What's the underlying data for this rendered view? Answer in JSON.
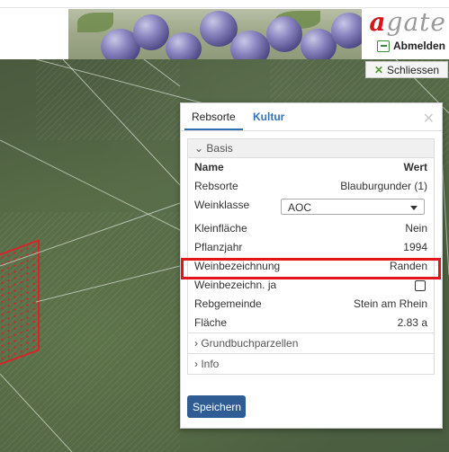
{
  "header": {
    "logo_a": "a",
    "logo_rest": "gate",
    "logout_label": "Abmelden"
  },
  "map": {
    "close_label": "Schliessen"
  },
  "dialog": {
    "tabs": [
      {
        "label": "Rebsorte",
        "active": true
      },
      {
        "label": "Kultur",
        "active": false
      }
    ],
    "close_glyph": "✕",
    "section_basis": "⌄ Basis",
    "columns": {
      "name": "Name",
      "value": "Wert"
    },
    "rows": {
      "rebsorte": {
        "label": "Rebsorte",
        "value": "Blauburgunder (1)"
      },
      "weinklasse": {
        "label": "Weinklasse",
        "value": "AOC"
      },
      "kleinflaeche": {
        "label": "Kleinfläche",
        "value": "Nein"
      },
      "pflanzjahr": {
        "label": "Pflanzjahr",
        "value": "1994"
      },
      "weinbezeichnung": {
        "label": "Weinbezeichnung",
        "value": "Randen"
      },
      "weinbezeichn_ja": {
        "label": "Weinbezeichn. ja",
        "checked": false
      },
      "rebgemeinde": {
        "label": "Rebgemeinde",
        "value": "Stein am Rhein"
      },
      "flaeche": {
        "label": "Fläche",
        "value": "2.83 a"
      }
    },
    "section_grundbuch": "› Grundbuchparzellen",
    "section_info": "› Info",
    "save_label": "Speichern"
  },
  "colors": {
    "accent_blue": "#2f5d93",
    "highlight_red": "#e2151d",
    "logo_red": "#d4171e"
  }
}
